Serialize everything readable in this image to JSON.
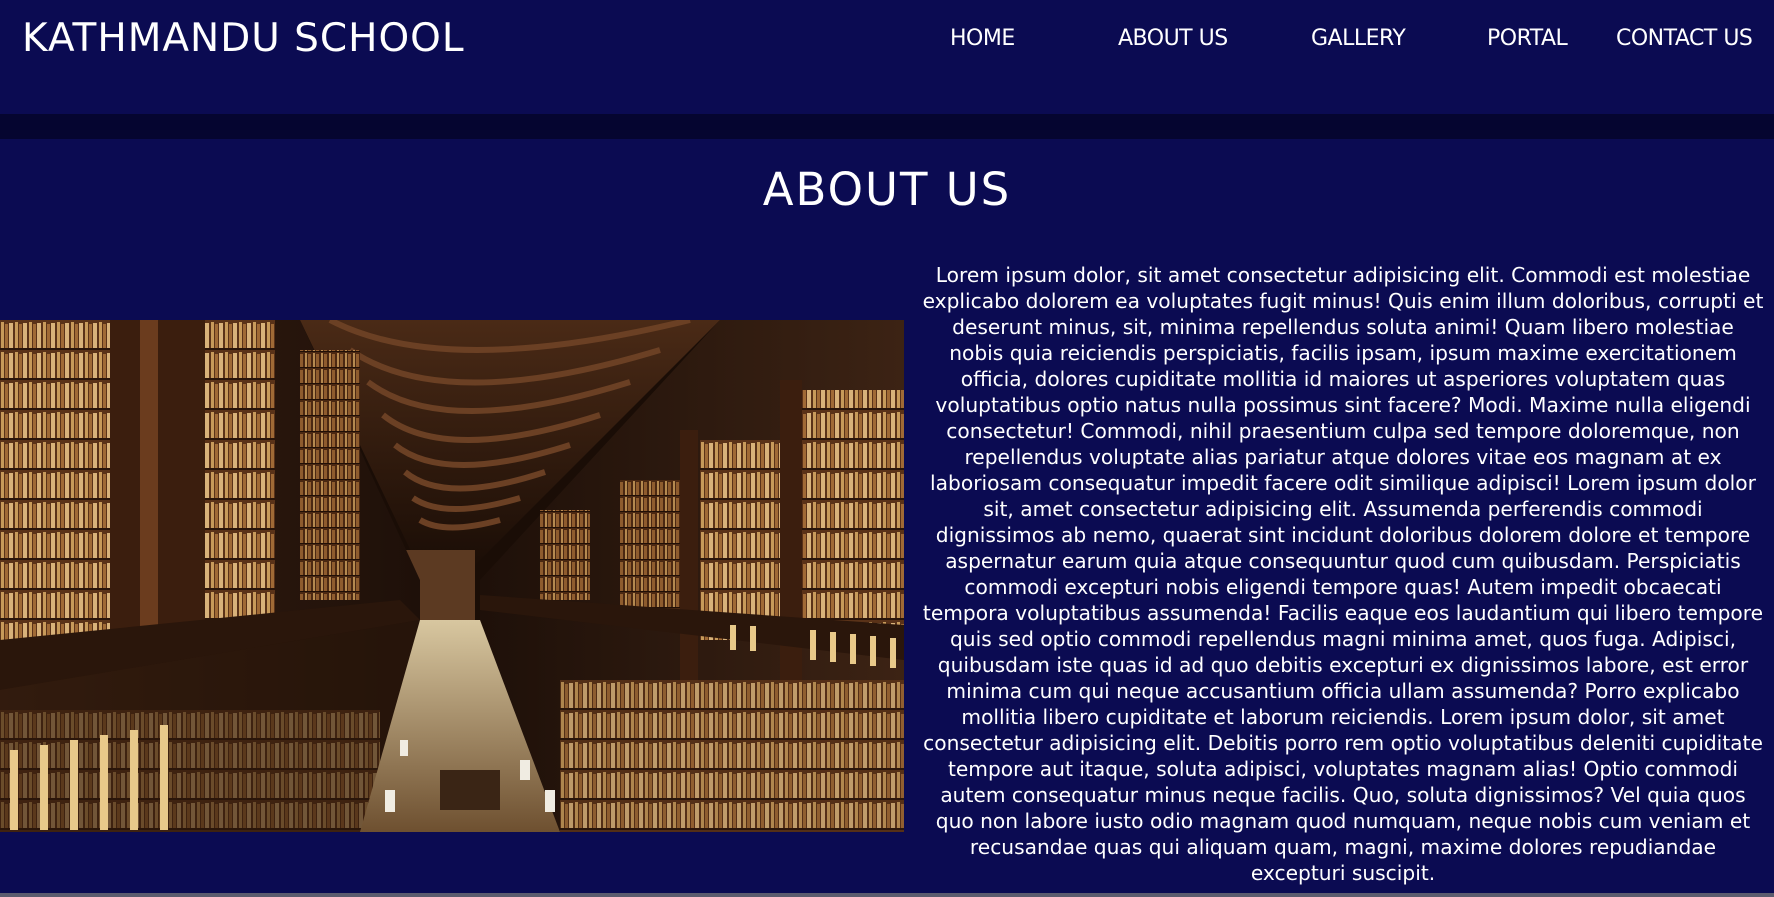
{
  "header": {
    "brand": "KATHMANDU SCHOOL",
    "nav": [
      {
        "label": "HOME"
      },
      {
        "label": "ABOUT US"
      },
      {
        "label": "GALLERY"
      },
      {
        "label": "PORTAL"
      },
      {
        "label": "CONTACT US"
      }
    ]
  },
  "main": {
    "title": "ABOUT US",
    "body": "Lorem ipsum dolor, sit amet consectetur adipisicing elit. Commodi est molestiae explicabo dolorem ea voluptates fugit minus! Quis enim illum doloribus, corrupti et deserunt minus, sit, minima repellendus soluta animi! Quam libero molestiae nobis quia reiciendis perspiciatis, facilis ipsam, ipsum maxime exercitationem officia, dolores cupiditate mollitia id maiores ut asperiores voluptatem quas voluptatibus optio natus nulla possimus sint facere? Modi. Maxime nulla eligendi consectetur! Commodi, nihil praesentium culpa sed tempore doloremque, non repellendus voluptate alias pariatur atque dolores vitae eos magnam at ex laboriosam consequatur impedit facere odit similique adipisci! Lorem ipsum dolor sit, amet consectetur adipisicing elit. Assumenda perferendis commodi dignissimos ab nemo, quaerat sint incidunt doloribus dolorem dolore et tempore aspernatur earum quia atque consequuntur quod cum quibusdam. Perspiciatis commodi excepturi nobis eligendi tempore quas! Autem impedit obcaecati tempora voluptatibus assumenda! Facilis eaque eos laudantium qui libero tempore quis sed optio commodi repellendus magni minima amet, quos fuga. Adipisci, quibusdam iste quas id ad quo debitis excepturi ex dignissimos labore, est error minima cum qui neque accusantium officia ullam assumenda? Porro explicabo mollitia libero cupiditate et laborum reiciendis. Lorem ipsum dolor, sit amet consectetur adipisicing elit. Debitis porro rem optio voluptatibus deleniti cupiditate tempore aut itaque, soluta adipisci, voluptates magnam alias! Optio commodi autem consequatur minus neque facilis. Quo, soluta dignissimos? Vel quia quos quo non labore iusto odio magnam quod numquam, neque nobis cum veniam et recusandae quas qui aliquam quam, magni, maxime dolores repudiandae excepturi suscipit."
  },
  "colors": {
    "background": "#0b0b52",
    "divider": "#050530",
    "text": "#ffffff"
  }
}
